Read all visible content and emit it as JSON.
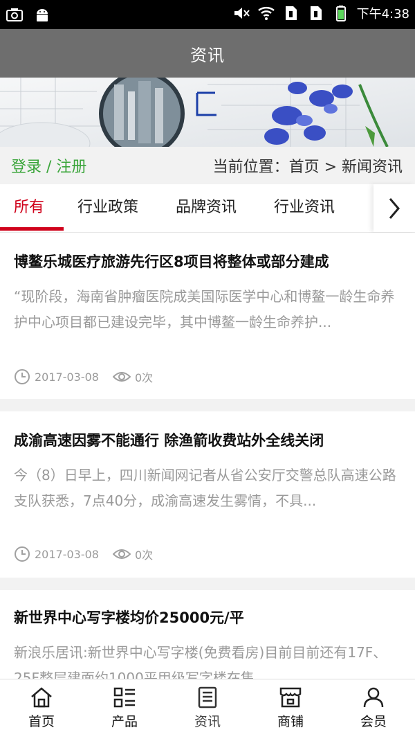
{
  "status_bar": {
    "time": "下午4:38",
    "icons_left": [
      "camera-icon",
      "android-icon"
    ],
    "icons_right": [
      "mute-icon",
      "wifi-icon",
      "sim1-icon",
      "sim2-icon",
      "battery-icon"
    ]
  },
  "header": {
    "title": "资讯"
  },
  "location_bar": {
    "login": "登录",
    "separator": " / ",
    "register": "注册",
    "breadcrumb": "当前位置：首页 > 新闻资讯"
  },
  "tabs": [
    {
      "label": "所有",
      "active": true
    },
    {
      "label": "行业政策",
      "active": false
    },
    {
      "label": "品牌资讯",
      "active": false
    },
    {
      "label": "行业资讯",
      "active": false
    }
  ],
  "articles": [
    {
      "title": "博鳌乐城医疗旅游先行区8项目将整体或部分建成",
      "summary": "“现阶段，海南省肿瘤医院成美国际医学中心和博鳌一龄生命养护中心项目都已建设完毕，其中博鳌一龄生命养护...",
      "date": "2017-03-08",
      "views": "0次"
    },
    {
      "title": "成渝高速因雾不能通行 除渔箭收费站外全线关闭",
      "summary": "今（8）日早上，四川新闻网记者从省公安厅交警总队高速公路支队获悉，7点40分，成渝高速发生雾情，不具...",
      "date": "2017-03-08",
      "views": "0次"
    },
    {
      "title": "新世界中心写字楼均价25000元/平",
      "summary": "新浪乐居讯:新世界中心写字楼(免费看房)目前目前还有17F、25F整层建面约1000平甲级写字楼在售",
      "date": "",
      "views": ""
    }
  ],
  "bottom_nav": [
    {
      "label": "首页",
      "icon": "home-icon"
    },
    {
      "label": "产品",
      "icon": "product-list-icon"
    },
    {
      "label": "资讯",
      "icon": "news-icon",
      "active": true
    },
    {
      "label": "商铺",
      "icon": "shop-icon"
    },
    {
      "label": "会员",
      "icon": "member-icon"
    }
  ],
  "colors": {
    "accent_red": "#d0021b",
    "login_green": "#3aa53a",
    "header_gray": "#6e6e6e"
  }
}
